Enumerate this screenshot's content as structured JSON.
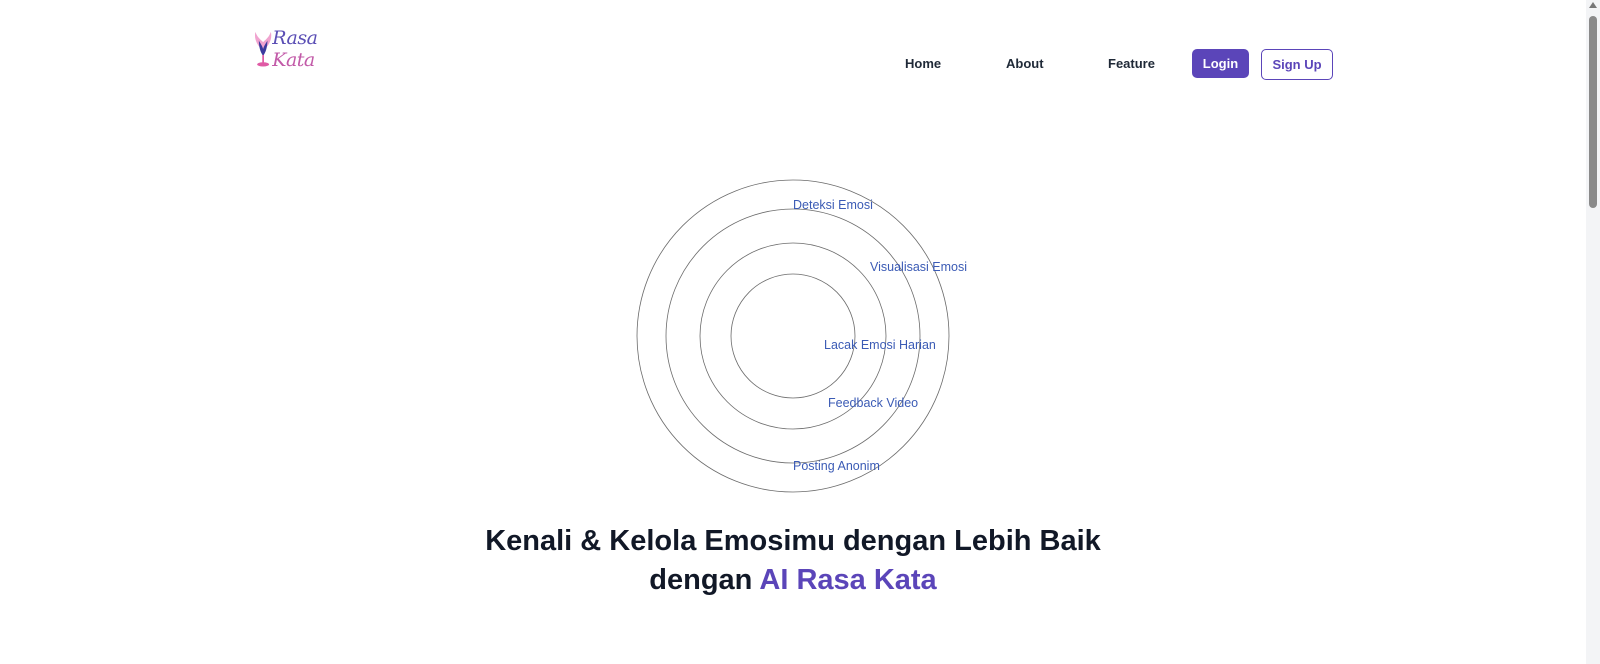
{
  "header": {
    "logo_text_a": "Rasa ",
    "logo_text_b": "Kata",
    "nav": [
      {
        "label": "Home"
      },
      {
        "label": "About"
      },
      {
        "label": "Feature"
      }
    ],
    "login_label": "Login",
    "signup_label": "Sign Up"
  },
  "features": [
    {
      "label": "Deteksi Emosi"
    },
    {
      "label": "Visualisasi Emosi"
    },
    {
      "label": "Lacak Emosi Harian"
    },
    {
      "label": "Feedback Video"
    },
    {
      "label": "Posting Anonim"
    }
  ],
  "hero": {
    "line1": "Kenali & Kelola Emosimu dengan Lebih Baik",
    "line2_prefix": "dengan ",
    "line2_accent": "AI Rasa Kata"
  },
  "colors": {
    "accent": "#5b45b9",
    "feature_text": "#3b5bb5",
    "logo_pink": "#e879b4"
  }
}
